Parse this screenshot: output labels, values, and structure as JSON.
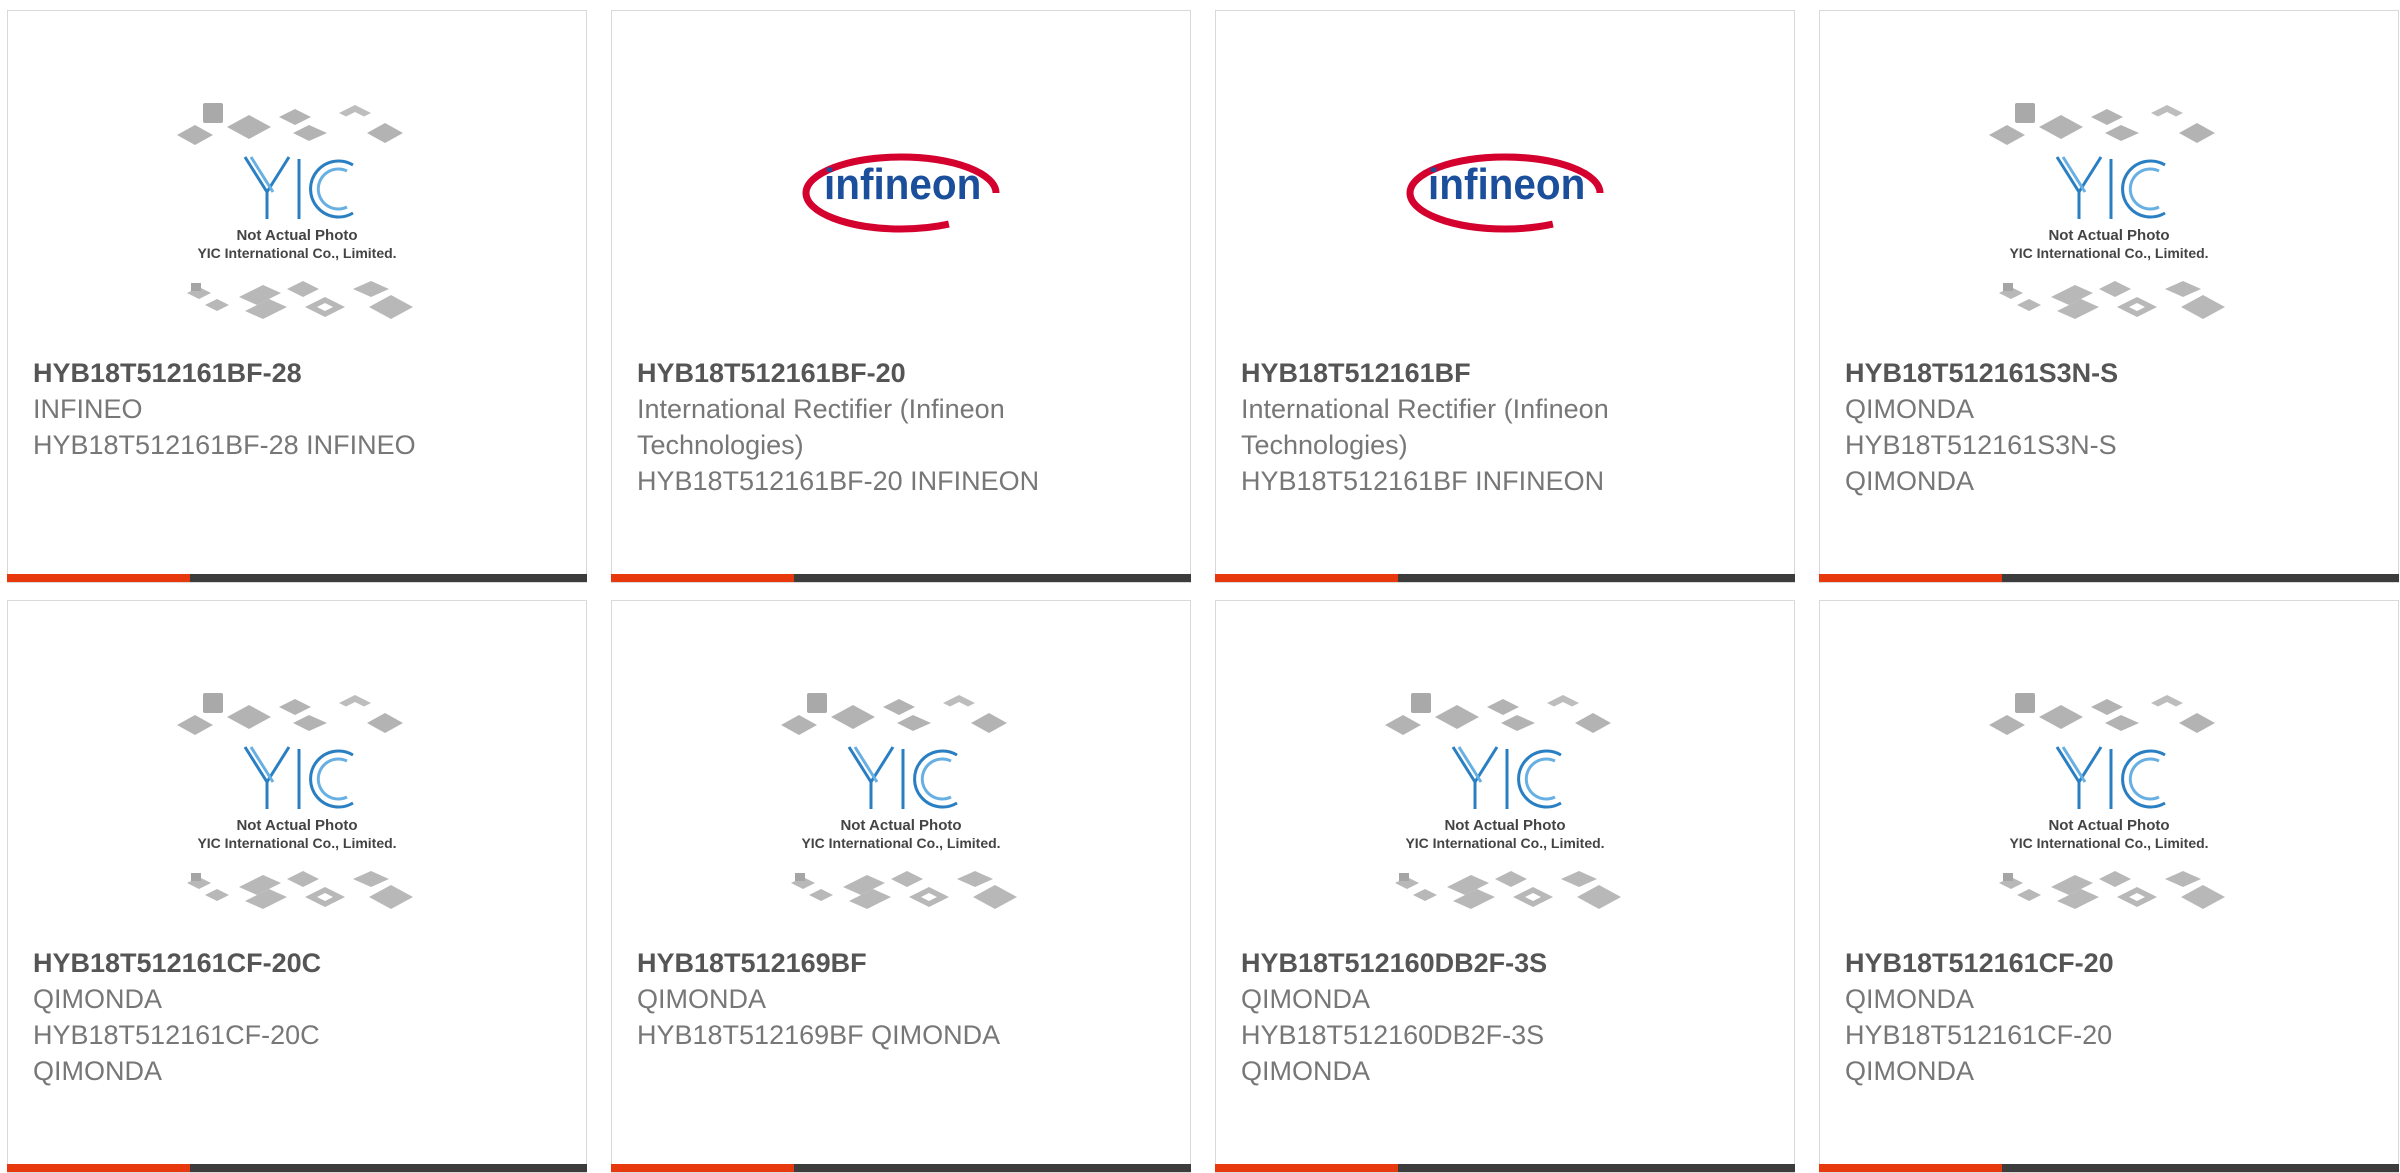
{
  "colors": {
    "accent": "#e8380d",
    "bar": "#3c3c3c",
    "border": "#d9d9d9",
    "text": "#777777",
    "title": "#555555",
    "yic_blue": "#2a7fc2",
    "infineon_blue": "#1b4f9c",
    "infineon_red": "#d4002d"
  },
  "placeholder_image": {
    "logo_text": "YIC",
    "line1": "Not Actual Photo",
    "line2": "YIC International Co., Limited."
  },
  "infineon_logo": {
    "text": "infineon"
  },
  "products": [
    {
      "part_number": "HYB18T512161BF-28",
      "image": "placeholder",
      "lines": [
        "INFINEO",
        "HYB18T512161BF-28 INFINEO"
      ]
    },
    {
      "part_number": "HYB18T512161BF-20",
      "image": "infineon",
      "lines": [
        "International Rectifier (Infineon",
        "Technologies)",
        "HYB18T512161BF-20 INFINEON"
      ]
    },
    {
      "part_number": "HYB18T512161BF",
      "image": "infineon",
      "lines": [
        "International Rectifier (Infineon",
        "Technologies)",
        "HYB18T512161BF INFINEON"
      ]
    },
    {
      "part_number": "HYB18T512161S3N-S",
      "image": "placeholder",
      "lines": [
        "QIMONDA",
        "HYB18T512161S3N-S",
        "QIMONDA"
      ]
    },
    {
      "part_number": "HYB18T512161CF-20C",
      "image": "placeholder",
      "lines": [
        "QIMONDA",
        "HYB18T512161CF-20C",
        "QIMONDA"
      ]
    },
    {
      "part_number": "HYB18T512169BF",
      "image": "placeholder",
      "lines": [
        "QIMONDA",
        "HYB18T512169BF QIMONDA"
      ]
    },
    {
      "part_number": "HYB18T512160DB2F-3S",
      "image": "placeholder",
      "lines": [
        "QIMONDA",
        "HYB18T512160DB2F-3S",
        "QIMONDA"
      ]
    },
    {
      "part_number": "HYB18T512161CF-20",
      "image": "placeholder",
      "lines": [
        "QIMONDA",
        "HYB18T512161CF-20",
        "QIMONDA"
      ]
    }
  ]
}
